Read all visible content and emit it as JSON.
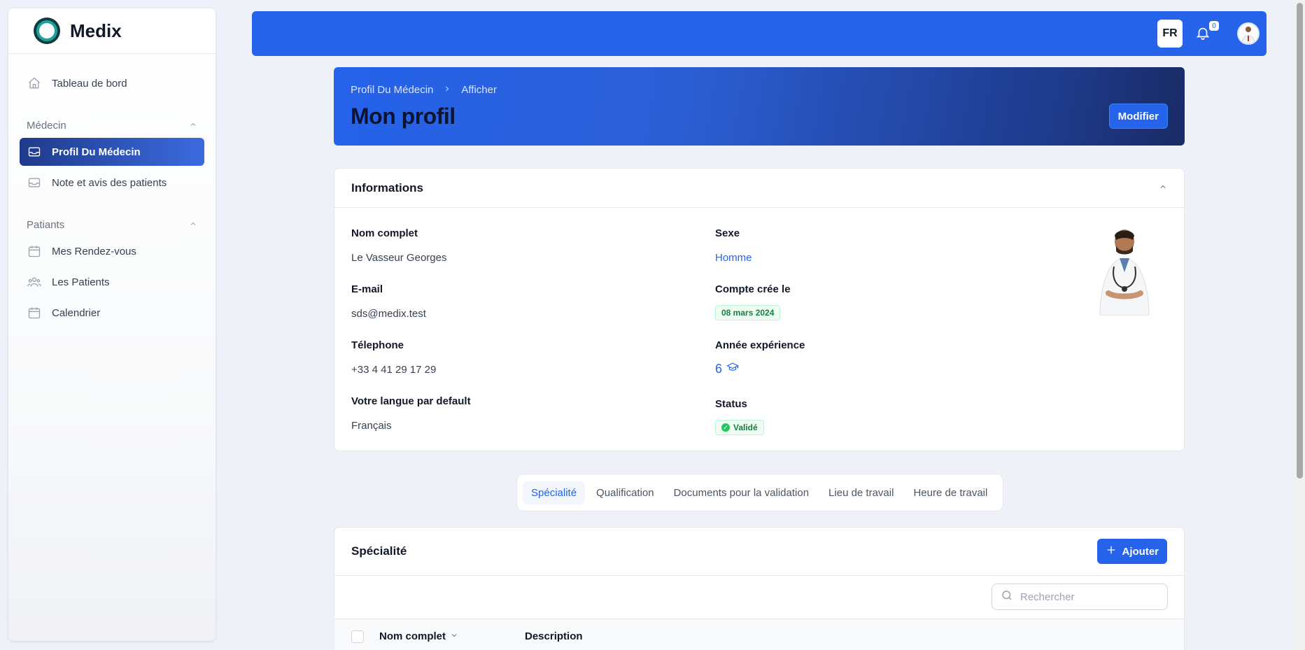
{
  "app": {
    "name": "Medix"
  },
  "sidebar": {
    "dashboard": "Tableau de bord",
    "groups": [
      {
        "label": "Médecin",
        "items": [
          {
            "label": "Profil Du Médecin",
            "icon": "inbox-icon",
            "active": true
          },
          {
            "label": "Note et avis des patients",
            "icon": "inbox-icon",
            "active": false
          }
        ]
      },
      {
        "label": "Patiants",
        "items": [
          {
            "label": "Mes Rendez-vous",
            "icon": "calendar-icon",
            "active": false
          },
          {
            "label": "Les Patients",
            "icon": "users-icon",
            "active": false
          },
          {
            "label": "Calendrier",
            "icon": "calendar-icon",
            "active": false
          }
        ]
      }
    ]
  },
  "topbar": {
    "lang": "FR",
    "notif_count": "0"
  },
  "header": {
    "breadcrumb": [
      "Profil Du Médecin",
      "Afficher"
    ],
    "title": "Mon profil",
    "edit_label": "Modifier"
  },
  "info": {
    "title": "Informations",
    "fields": {
      "fullname": {
        "label": "Nom complet",
        "value": "Le Vasseur Georges"
      },
      "email": {
        "label": "E-mail",
        "value": "sds@medix.test"
      },
      "phone": {
        "label": "Télephone",
        "value": "+33 4 41 29 17 29"
      },
      "lang": {
        "label": "Votre langue par default",
        "value": "Français"
      },
      "sex": {
        "label": "Sexe",
        "value": "Homme"
      },
      "created": {
        "label": "Compte crée le",
        "value": "08 mars 2024"
      },
      "experience": {
        "label": "Année expérience",
        "value": "6"
      },
      "status": {
        "label": "Status",
        "value": "Validé"
      }
    }
  },
  "tabs": [
    "Spécialité",
    "Qualification",
    "Documents pour la validation",
    "Lieu de travail",
    "Heure de travail"
  ],
  "specialty": {
    "title": "Spécialité",
    "add_label": "Ajouter",
    "search_placeholder": "Rechercher",
    "columns": [
      "Nom complet",
      "Description"
    ]
  },
  "colors": {
    "primary": "#2563eb",
    "success": "#22c55e"
  }
}
